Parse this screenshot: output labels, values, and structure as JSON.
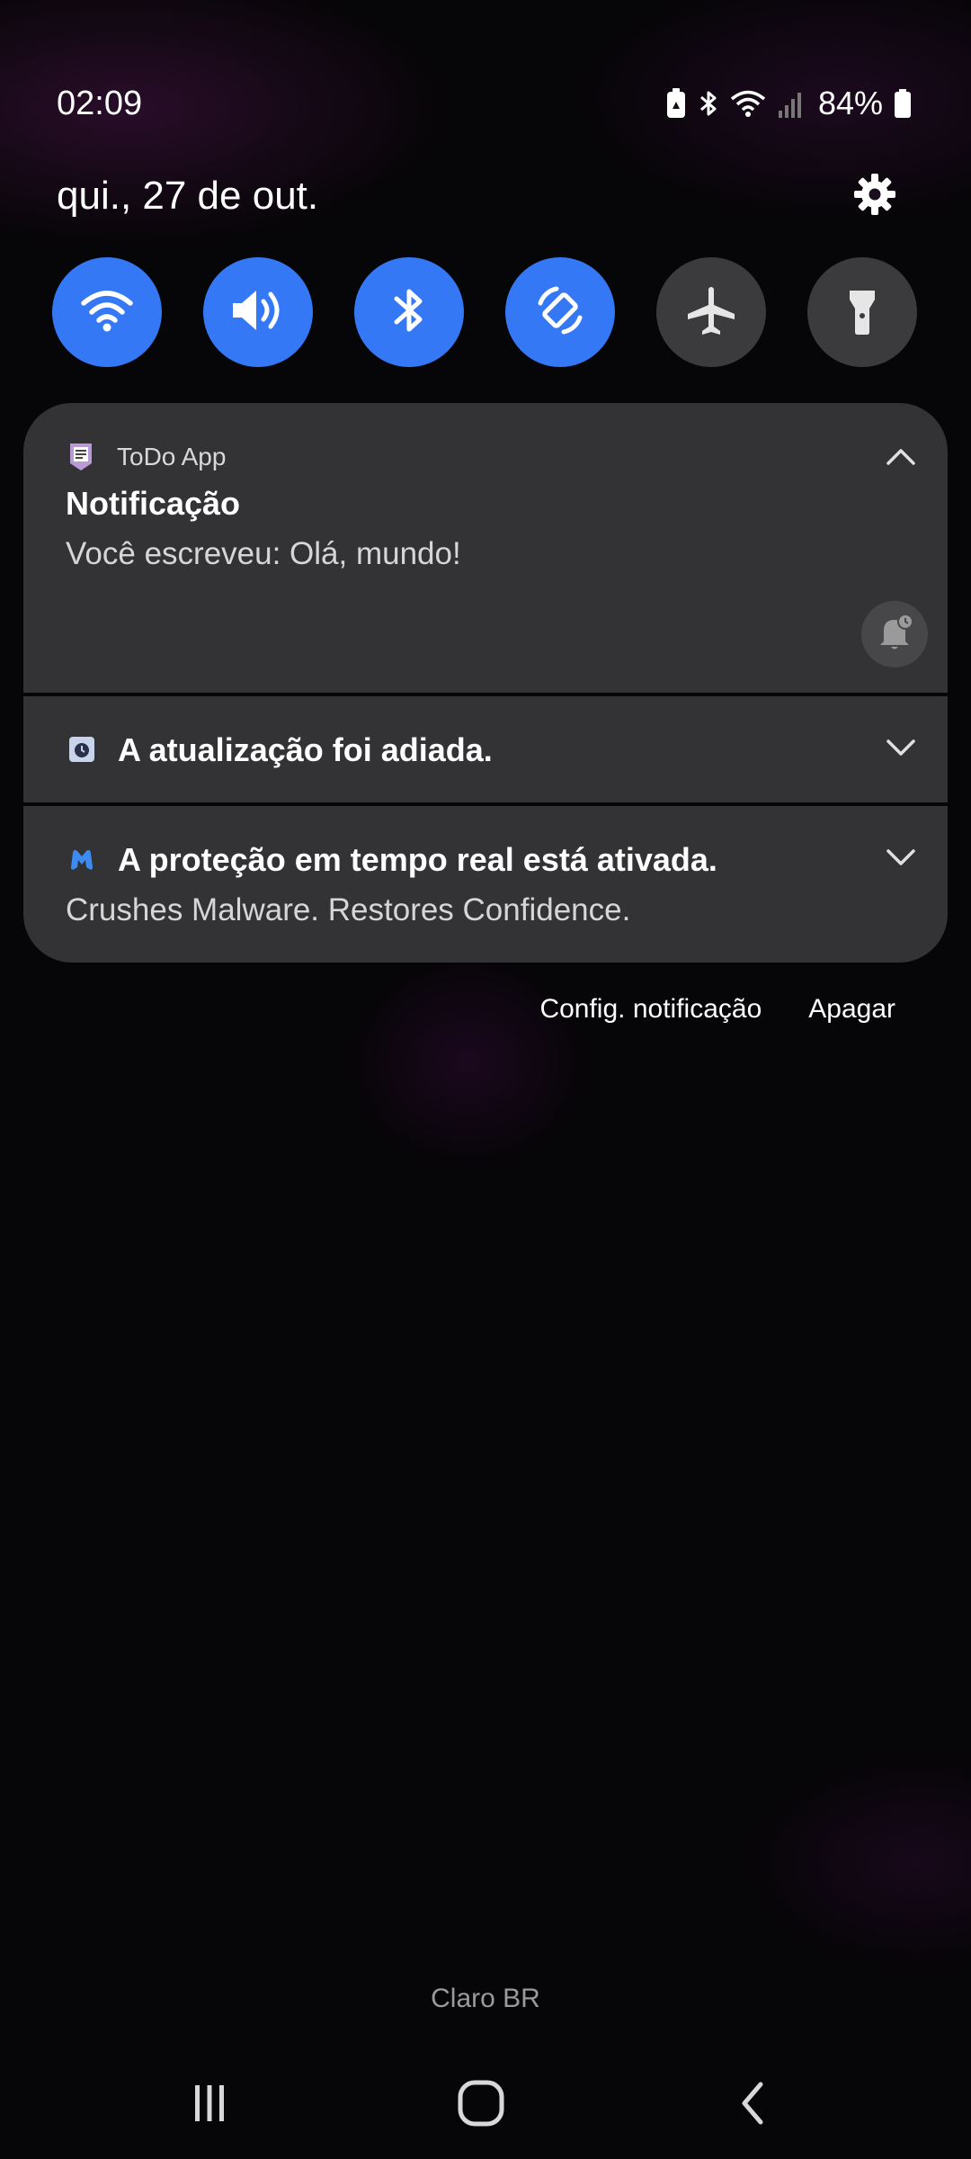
{
  "status_bar": {
    "time": "02:09",
    "battery_percent": "84%",
    "icons": [
      "battery-saver-icon",
      "bluetooth-icon",
      "wifi-icon",
      "signal-icon",
      "battery-icon"
    ]
  },
  "header": {
    "date": "qui., 27 de out.",
    "settings_icon": "gear-icon"
  },
  "quick_toggles": [
    {
      "name": "wifi",
      "icon": "wifi-icon",
      "on": true
    },
    {
      "name": "sound",
      "icon": "speaker-icon",
      "on": true
    },
    {
      "name": "bluetooth",
      "icon": "bluetooth-icon",
      "on": true
    },
    {
      "name": "auto-rotate",
      "icon": "rotate-icon",
      "on": true
    },
    {
      "name": "airplane-mode",
      "icon": "airplane-icon",
      "on": false
    },
    {
      "name": "flashlight",
      "icon": "flashlight-icon",
      "on": false
    }
  ],
  "notifications": [
    {
      "app_name": "ToDo App",
      "title": "Notificação",
      "text": "Você escreveu: Olá, mundo!",
      "expanded": true
    },
    {
      "title": "A atualização foi adiada.",
      "expanded": false
    },
    {
      "title": "A proteção em tempo real está ativada.",
      "text": "Crushes Malware. Restores Confidence.",
      "expanded": false
    }
  ],
  "notification_actions": {
    "settings_label": "Config. notificação",
    "clear_label": "Apagar"
  },
  "carrier": "Claro BR",
  "colors": {
    "toggle_on": "#3478f6",
    "toggle_off": "#3b3b3d",
    "card": "#333335"
  }
}
